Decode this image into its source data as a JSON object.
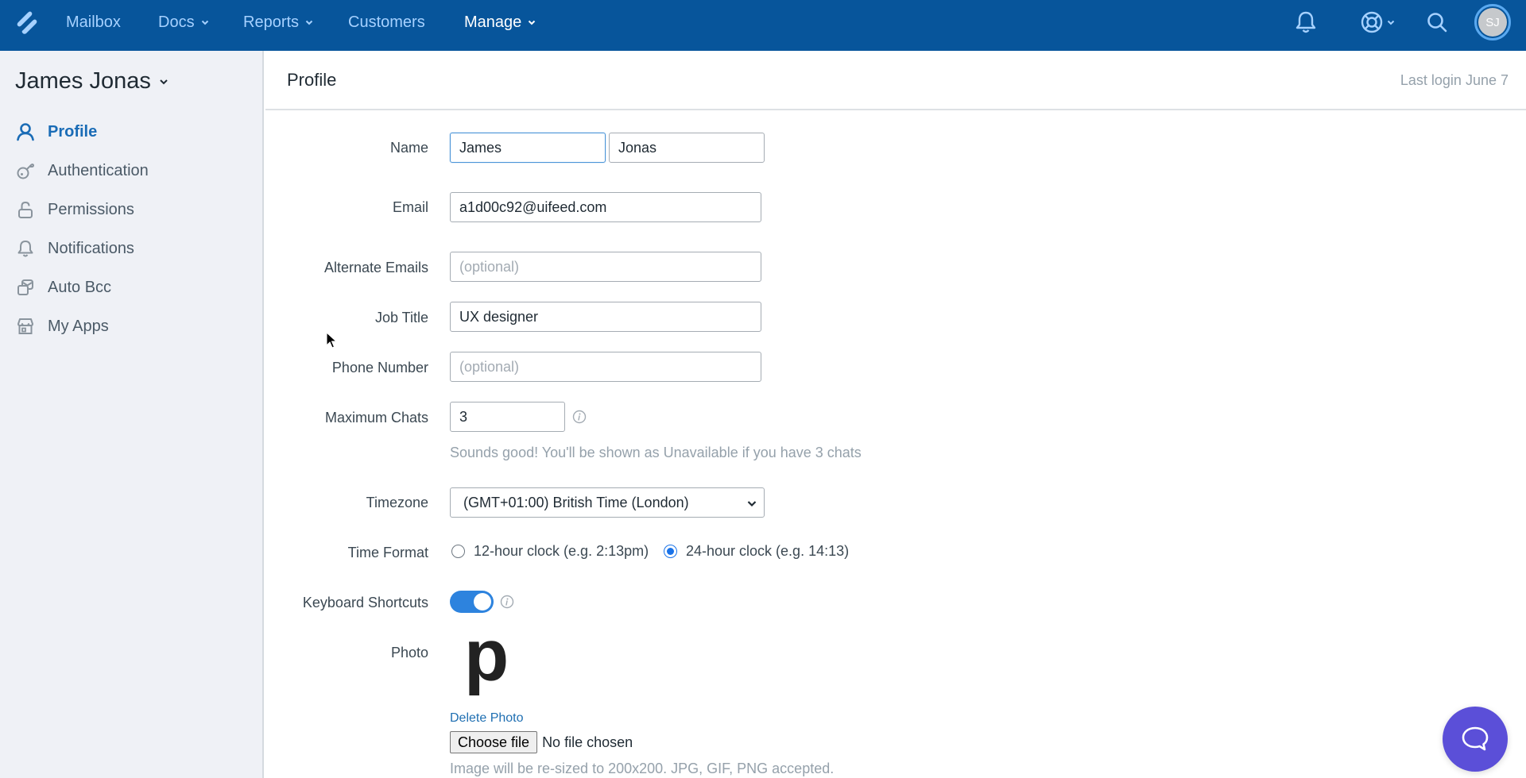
{
  "topnav": {
    "logo": "helpscout-logo",
    "items": [
      {
        "label": "Mailbox",
        "has_dropdown": false,
        "active": false
      },
      {
        "label": "Docs",
        "has_dropdown": true,
        "active": false
      },
      {
        "label": "Reports",
        "has_dropdown": true,
        "active": false
      },
      {
        "label": "Customers",
        "has_dropdown": false,
        "active": false
      },
      {
        "label": "Manage",
        "has_dropdown": true,
        "active": true
      }
    ],
    "icons": [
      "bell-icon",
      "help-lifebuoy-icon",
      "search-icon"
    ],
    "avatar_initials": "SJ",
    "colors": {
      "background": "#07559b",
      "link": "#a6d1ff",
      "active": "#ffffff"
    }
  },
  "sidebar": {
    "user_name": "James Jonas",
    "items": [
      {
        "label": "Profile",
        "icon": "user-icon",
        "active": true
      },
      {
        "label": "Authentication",
        "icon": "key-icon",
        "active": false
      },
      {
        "label": "Permissions",
        "icon": "unlock-icon",
        "active": false
      },
      {
        "label": "Notifications",
        "icon": "bell-icon",
        "active": false
      },
      {
        "label": "Auto Bcc",
        "icon": "copy-mail-icon",
        "active": false
      },
      {
        "label": "My Apps",
        "icon": "store-icon",
        "active": false
      }
    ]
  },
  "header": {
    "title": "Profile",
    "last_login": "Last login June 7"
  },
  "form": {
    "name": {
      "label": "Name",
      "first": "James",
      "last": "Jonas"
    },
    "email": {
      "label": "Email",
      "value": "a1d00c92@uifeed.com"
    },
    "alternate_emails": {
      "label": "Alternate Emails",
      "value": "",
      "placeholder": "(optional)"
    },
    "job_title": {
      "label": "Job Title",
      "value": "UX designer"
    },
    "phone": {
      "label": "Phone Number",
      "value": "",
      "placeholder": "(optional)"
    },
    "max_chats": {
      "label": "Maximum Chats",
      "value": "3",
      "hint": "Sounds good! You'll be shown as Unavailable if you have 3 chats"
    },
    "timezone": {
      "label": "Timezone",
      "selected": "(GMT+01:00) British Time (London)"
    },
    "time_format": {
      "label": "Time Format",
      "options": [
        {
          "label": "12-hour clock (e.g. 2:13pm)",
          "checked": false
        },
        {
          "label": "24-hour clock (e.g. 14:13)",
          "checked": true
        }
      ]
    },
    "keyboard_shortcuts": {
      "label": "Keyboard Shortcuts",
      "enabled": true
    },
    "photo": {
      "label": "Photo",
      "glyph": "p",
      "delete_label": "Delete Photo",
      "choose_file_label": "Choose file",
      "file_status": "No file chosen",
      "hint": "Image will be re-sized to 200x200. JPG, GIF, PNG accepted."
    }
  },
  "chat_widget": {
    "icon": "chat-bubble-icon",
    "color": "#5b4fd8"
  }
}
